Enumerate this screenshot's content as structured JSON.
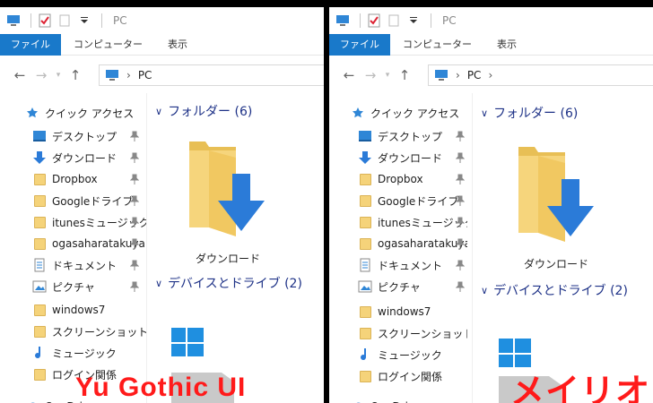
{
  "left": {
    "title": "PC",
    "ribbon": [
      "ファイル",
      "コンピューター",
      "表示"
    ],
    "breadcrumb": "PC",
    "sidebar": [
      {
        "label": "クイック アクセス",
        "icon": "star-icon",
        "pinned": false
      },
      {
        "label": "デスクトップ",
        "icon": "desktop-icon",
        "pinned": true
      },
      {
        "label": "ダウンロード",
        "icon": "download-arrow-icon",
        "pinned": true
      },
      {
        "label": "Dropbox",
        "icon": "folder-icon",
        "pinned": true
      },
      {
        "label": "Googleドライブ",
        "icon": "folder-icon",
        "pinned": true
      },
      {
        "label": "itunesミュージック",
        "icon": "folder-icon",
        "pinned": true
      },
      {
        "label": "ogasaharatakuya",
        "icon": "folder-icon",
        "pinned": true
      },
      {
        "label": "ドキュメント",
        "icon": "document-icon",
        "pinned": true
      },
      {
        "label": "ピクチャ",
        "icon": "pictures-icon",
        "pinned": true
      },
      {
        "label": "windows7",
        "icon": "folder-icon",
        "pinned": false
      },
      {
        "label": "スクリーンショット",
        "icon": "folder-icon",
        "pinned": false
      },
      {
        "label": "ミュージック",
        "icon": "music-icon",
        "pinned": false
      },
      {
        "label": "ログイン関係",
        "icon": "folder-icon",
        "pinned": false
      },
      {
        "label": "OneDrive",
        "icon": "onedrive-icon",
        "pinned": false
      }
    ],
    "group_folders": "フォルダー (6)",
    "item_download": "ダウンロード",
    "group_devices": "デバイスとドライブ (2)",
    "caption": "Yu Gothic UI"
  },
  "right": {
    "title": "PC",
    "ribbon": [
      "ファイル",
      "コンピューター",
      "表示"
    ],
    "breadcrumb": "PC",
    "sidebar": [
      {
        "label": "クイック アクセス",
        "icon": "star-icon",
        "pinned": false
      },
      {
        "label": "デスクトップ",
        "icon": "desktop-icon",
        "pinned": true
      },
      {
        "label": "ダウンロード",
        "icon": "download-arrow-icon",
        "pinned": true
      },
      {
        "label": "Dropbox",
        "icon": "folder-icon",
        "pinned": true
      },
      {
        "label": "Googleドライブ",
        "icon": "folder-icon",
        "pinned": true
      },
      {
        "label": "itunesミュージック",
        "icon": "folder-icon",
        "pinned": true
      },
      {
        "label": "ogasaharatakuya",
        "icon": "folder-icon",
        "pinned": true
      },
      {
        "label": "ドキュメント",
        "icon": "document-icon",
        "pinned": true
      },
      {
        "label": "ピクチャ",
        "icon": "pictures-icon",
        "pinned": true
      },
      {
        "label": "windows7",
        "icon": "folder-icon",
        "pinned": false
      },
      {
        "label": "スクリーンショット",
        "icon": "folder-icon",
        "pinned": false
      },
      {
        "label": "ミュージック",
        "icon": "music-icon",
        "pinned": false
      },
      {
        "label": "ログイン関係",
        "icon": "folder-icon",
        "pinned": false
      },
      {
        "label": "OneDrive",
        "icon": "onedrive-icon",
        "pinned": false
      }
    ],
    "group_folders": "フォルダー (6)",
    "item_download": "ダウンロード",
    "group_devices": "デバイスとドライブ (2)",
    "caption": "メイリオ"
  },
  "colors": {
    "accent": "#1979ca",
    "group_header": "#1e3287",
    "caption": "#ff1a1a",
    "folder": "#f5d37a",
    "download_arrow": "#2b7bd8"
  }
}
